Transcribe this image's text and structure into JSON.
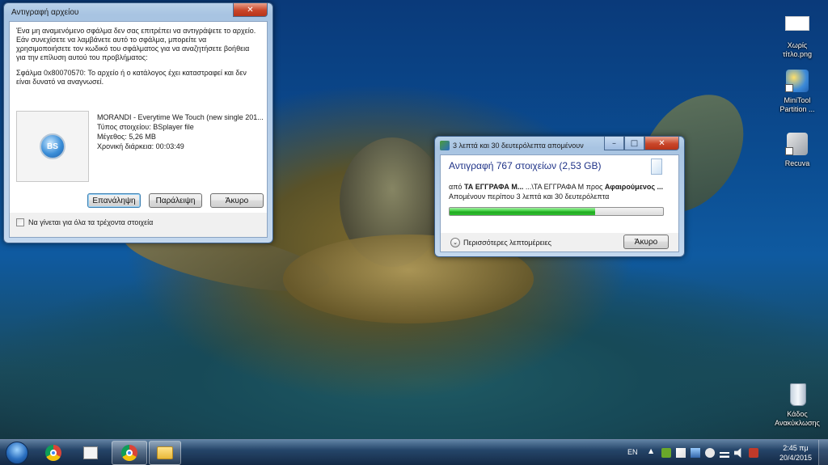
{
  "error_dialog": {
    "title": "Αντιγραφή αρχείου",
    "message": "Ένα μη αναμενόμενο σφάλμα δεν σας επιτρέπει να αντιγράψετε το αρχείο. Εάν συνεχίσετε να λαμβάνετε αυτό το σφάλμα, μπορείτε να χρησιμοποιήσετε τον κωδικό του σφάλματος για να αναζητήσετε βοήθεια για την επίλυση αυτού του προβλήματος:",
    "error_code": "Σφάλμα 0x80070570: Το αρχείο ή ο κατάλογος έχει καταστραφεί και δεν είναι δυνατό να αναγνωσεί.",
    "file": {
      "thumb_text": "BS",
      "name": "MORANDI - Everytime We Touch (new single 201...",
      "type": "Τύπος στοιχείου: BSplayer file",
      "size": "Μέγεθος: 5,26 MB",
      "duration": "Χρονική διάρκεια: 00:03:49"
    },
    "retry_label": "Επανάληψη",
    "skip_label": "Παράλειψη",
    "cancel_label": "Άκυρο",
    "checkbox_label": "Να γίνεται για όλα τα τρέχοντα στοιχεία"
  },
  "progress_dialog": {
    "title": "3 λεπτά και 30 δευτερόλεπτα απομένουν",
    "heading": "Αντιγραφή 767 στοιχείων (2,53 GB)",
    "from_label": "από",
    "from_value": "ΤΑ ΕΓΓΡΑΦΑ Μ...",
    "path_middle": "...\\ΤΑ ΕΓΓΡΑΦΑ Μ",
    "to_label": "προς",
    "to_value": "Αφαιρούμενος ...",
    "remaining": "Απομένουν περίπου 3 λεπτά και 30 δευτερόλεπτα",
    "progress_fraction": 0.68,
    "more_details": "Περισσότερες λεπτομέρειες",
    "cancel_label": "Άκυρο"
  },
  "desktop_icons": [
    {
      "label": "Χωρίς τίτλο.png"
    },
    {
      "label": "MiniTool Partition ..."
    },
    {
      "label": "Recuva"
    },
    {
      "label": "Κάδος Ανακύκλωσης"
    }
  ],
  "taskbar": {
    "language": "EN",
    "time": "2:45 πμ",
    "date": "20/4/2015"
  },
  "colors": {
    "progress_green": "#2fbf2f",
    "heading_blue": "#1e3287"
  }
}
